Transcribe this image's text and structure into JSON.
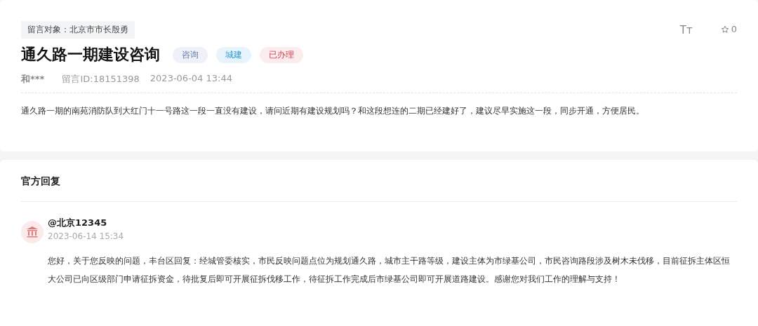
{
  "message": {
    "recipient": "留言对象：北京市市长殷勇",
    "title": "通久路一期建设咨询",
    "tags": [
      {
        "label": "咨询",
        "color": "#eef1f7"
      },
      {
        "label": "城建",
        "color": "#e8f4fb"
      },
      {
        "label": "已办理",
        "color": "#fdecee"
      }
    ],
    "author": "和***",
    "message_id": "留言ID:18151398",
    "time": "2023-06-04 13:44",
    "font_size_toggle": "Tт",
    "favorites": "0",
    "body": "通久路一期的南苑消防队到大红门十一号路这一段一直没有建设，请问近期有建设规划吗？和这段想连的二期已经建好了，建议尽早实施这一段，同步开通，方便居民。"
  },
  "reply": {
    "heading": "官方回复",
    "responder": "@北京12345",
    "time": "2023-06-14 15:34",
    "body": "您好，关于您反映的问题，丰台区回复：经城管委核实，市民反映问题点位为规划通久路，城市主干路等级，建设主体为市绿基公司，市民咨询路段涉及树木未伐移，目前征拆主体区恒大公司已向区级部门申请征拆资金，待批复后即可开展征拆伐移工作，待征拆工作完成后市绿基公司即可开展道路建设。感谢您对我们工作的理解与支持！"
  }
}
